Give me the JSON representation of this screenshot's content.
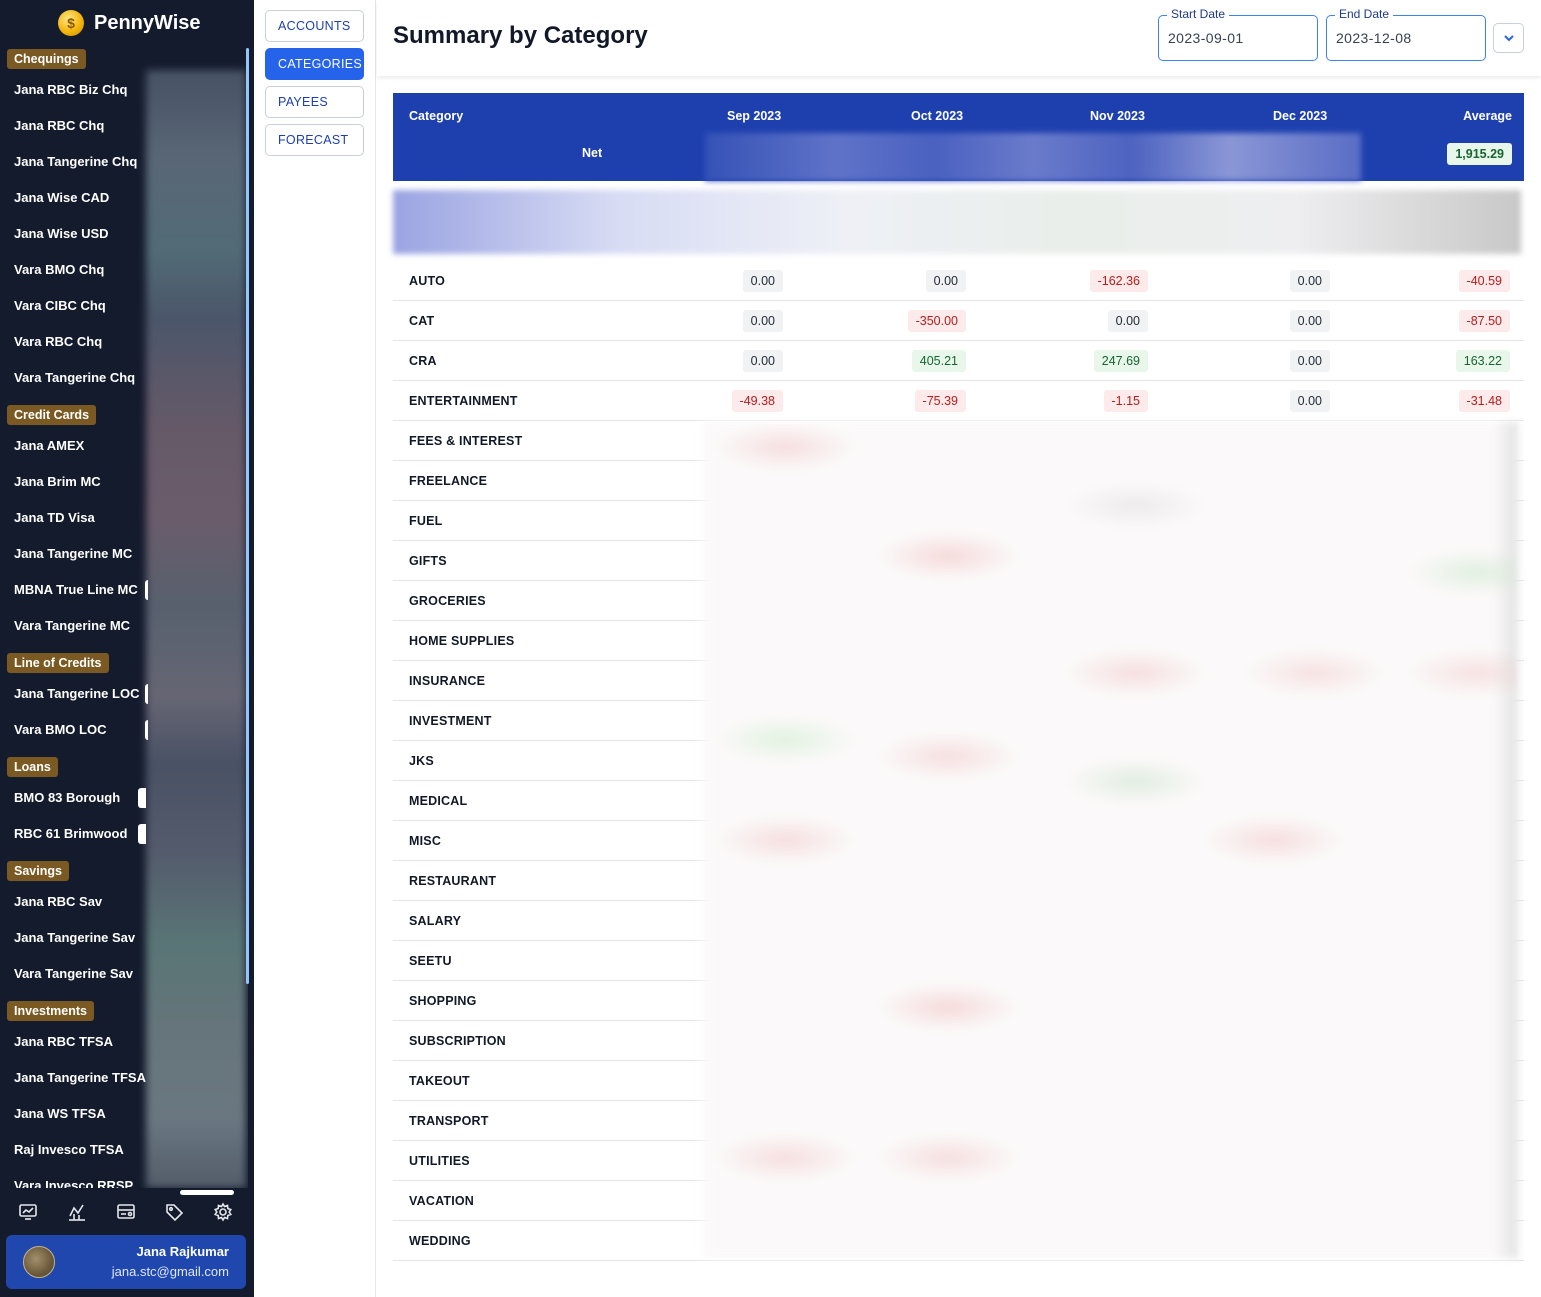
{
  "brand": {
    "name": "PennyWise",
    "logo_glyph": "$"
  },
  "sidebar": {
    "groups": [
      {
        "label": "Chequings",
        "items": [
          "Jana RBC Biz Chq",
          "Jana RBC Chq",
          "Jana Tangerine Chq",
          "Jana Wise CAD",
          "Jana Wise USD",
          "Vara BMO Chq",
          "Vara CIBC Chq",
          "Vara RBC Chq",
          "Vara Tangerine Chq"
        ]
      },
      {
        "label": "Credit Cards",
        "items": [
          "Jana AMEX",
          "Jana Brim MC",
          "Jana TD Visa",
          "Jana Tangerine MC",
          "MBNA True Line MC",
          "Vara Tangerine MC"
        ]
      },
      {
        "label": "Line of Credits",
        "items": [
          "Jana Tangerine LOC",
          "Vara BMO LOC"
        ]
      },
      {
        "label": "Loans",
        "items": [
          "BMO 83 Borough",
          "RBC 61 Brimwood"
        ]
      },
      {
        "label": "Savings",
        "items": [
          "Jana RBC Sav",
          "Jana Tangerine Sav",
          "Vara Tangerine Sav"
        ]
      },
      {
        "label": "Investments",
        "items": [
          "Jana RBC TFSA",
          "Jana Tangerine TFSA",
          "Jana WS TFSA",
          "Raj Invesco TFSA",
          "Vara Invesco RRSP"
        ]
      }
    ],
    "bottom_nav_icons": [
      "dashboard-icon",
      "chart-icon",
      "transactions-icon",
      "tag-icon",
      "settings-icon"
    ]
  },
  "user": {
    "name": "Jana Rajkumar",
    "email": "jana.stc@gmail.com"
  },
  "subnav": {
    "items": [
      "ACCOUNTS",
      "CATEGORIES",
      "PAYEES",
      "FORECAST"
    ],
    "active": "CATEGORIES"
  },
  "header": {
    "title": "Summary by Category",
    "start_date": {
      "label": "Start Date",
      "value": "2023-09-01"
    },
    "end_date": {
      "label": "End Date",
      "value": "2023-12-08"
    }
  },
  "table": {
    "columns": [
      "Category",
      "Sep 2023",
      "Oct 2023",
      "Nov 2023",
      "Dec 2023",
      "Average"
    ],
    "net": {
      "label": "Net",
      "average": "1,915.29"
    },
    "rows": [
      {
        "category": "AUTO",
        "values": [
          "0.00",
          "0.00",
          "-162.36",
          "0.00",
          "-40.59"
        ]
      },
      {
        "category": "CAT",
        "values": [
          "0.00",
          "-350.00",
          "0.00",
          "0.00",
          "-87.50"
        ]
      },
      {
        "category": "CRA",
        "values": [
          "0.00",
          "405.21",
          "247.69",
          "0.00",
          "163.22"
        ]
      },
      {
        "category": "ENTERTAINMENT",
        "values": [
          "-49.38",
          "-75.39",
          "-1.15",
          "0.00",
          "-31.48"
        ]
      },
      {
        "category": "FEES & INTEREST",
        "values": []
      },
      {
        "category": "FREELANCE",
        "values": []
      },
      {
        "category": "FUEL",
        "values": []
      },
      {
        "category": "GIFTS",
        "values": []
      },
      {
        "category": "GROCERIES",
        "values": []
      },
      {
        "category": "HOME SUPPLIES",
        "values": []
      },
      {
        "category": "INSURANCE",
        "values": []
      },
      {
        "category": "INVESTMENT",
        "values": []
      },
      {
        "category": "JKS",
        "values": []
      },
      {
        "category": "MEDICAL",
        "values": []
      },
      {
        "category": "MISC",
        "values": []
      },
      {
        "category": "RESTAURANT",
        "values": []
      },
      {
        "category": "SALARY",
        "values": []
      },
      {
        "category": "SEETU",
        "values": []
      },
      {
        "category": "SHOPPING",
        "values": []
      },
      {
        "category": "SUBSCRIPTION",
        "values": []
      },
      {
        "category": "TAKEOUT",
        "values": []
      },
      {
        "category": "TRANSPORT",
        "values": []
      },
      {
        "category": "UTILITIES",
        "values": []
      },
      {
        "category": "VACATION",
        "values": []
      },
      {
        "category": "WEDDING",
        "values": []
      }
    ]
  },
  "colors": {
    "sidebar_bg": "#141b2d",
    "accent": "#1e40af",
    "active_button": "#2563eb",
    "group_badge": "#7a5a22",
    "negative": "#b91c1c",
    "positive": "#166534"
  }
}
